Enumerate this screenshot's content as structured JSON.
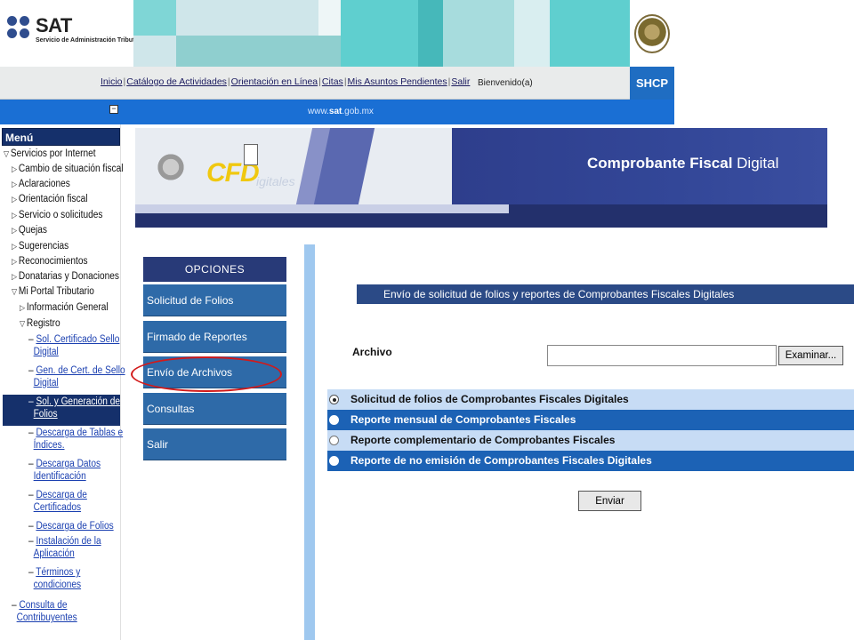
{
  "header": {
    "brand": "SAT",
    "brand_subtitle": "Servicio de Administración Tributaria",
    "shcp": "SHCP"
  },
  "nav": {
    "links": [
      "Inicio",
      "Catálogo de Actividades",
      "Orientación en Línea",
      "Citas",
      "Mis Asuntos Pendientes",
      "Salir"
    ],
    "welcome": "Bienvenido(a)"
  },
  "urlbar": {
    "prefix": "www.",
    "bold": "sat",
    "suffix": ".gob.mx"
  },
  "menu": {
    "title": "Menú",
    "items": [
      {
        "label": "Servicios por Internet",
        "marker": "▽"
      },
      {
        "label": "Cambio de situación fiscal",
        "marker": "▷"
      },
      {
        "label": "Aclaraciones",
        "marker": "▷"
      },
      {
        "label": "Orientación fiscal",
        "marker": "▷"
      },
      {
        "label": "Servicio o solicitudes",
        "marker": "▷"
      },
      {
        "label": "Quejas",
        "marker": "▷"
      },
      {
        "label": "Sugerencias",
        "marker": "▷"
      },
      {
        "label": "Reconocimientos",
        "marker": "▷"
      },
      {
        "label": "Donatarias y Donaciones",
        "marker": "▷"
      },
      {
        "label": "Mi Portal Tributario",
        "marker": "▽"
      },
      {
        "label": "Información General",
        "marker": "▷"
      },
      {
        "label": "Registro",
        "marker": "▽"
      }
    ],
    "sub_links": [
      {
        "line1": "Sol. Certificado Sello",
        "line2": "Digital"
      },
      {
        "line1": "Gen. de Cert. de Sello",
        "line2": "Digital"
      },
      {
        "line1": "Sol. y Generación de",
        "line2": "Folios"
      },
      {
        "line1": "Descarga de Tablas e",
        "line2": "Índices."
      },
      {
        "line1": "Descarga Datos",
        "line2": "Identificación"
      },
      {
        "line1": "Descarga de",
        "line2": "Certificados"
      },
      {
        "line1": "Descarga de Folios",
        "line2": ""
      },
      {
        "line1": "Instalación de la",
        "line2": "Aplicación"
      },
      {
        "line1": "Términos y",
        "line2": "condiciones"
      }
    ],
    "bottom_link": {
      "line1": "Consulta de",
      "line2": "Contribuyentes"
    }
  },
  "cfd_banner": {
    "logo": "CFD",
    "logo_sub": "igitales",
    "title_bold": "Comprobante Fiscal ",
    "title_light": "Digital"
  },
  "options": {
    "header": "OPCIONES",
    "items": [
      "Solicitud de Folios",
      "Firmado de Reportes",
      "Envío de Archivos",
      "Consultas",
      "Salir"
    ]
  },
  "form": {
    "title": "Envío de solicitud de folios y reportes de Comprobantes Fiscales Digitales",
    "archivo_label": "Archivo",
    "archivo_value": "",
    "browse_label": "Examinar...",
    "radios": [
      "Solicitud de folios de Comprobantes Fiscales Digitales",
      "Reporte mensual de Comprobantes Fiscales",
      "Reporte complementario de Comprobantes Fiscales",
      "Reporte de no emisión de Comprobantes Fiscales Digitales"
    ],
    "selected_radio": 0,
    "send_label": "Enviar"
  },
  "colors": {
    "nav_blue": "#1a6fd4",
    "menu_dark": "#15306b",
    "option_blue": "#2e6aa8",
    "highlight_red": "#d21a1a"
  }
}
